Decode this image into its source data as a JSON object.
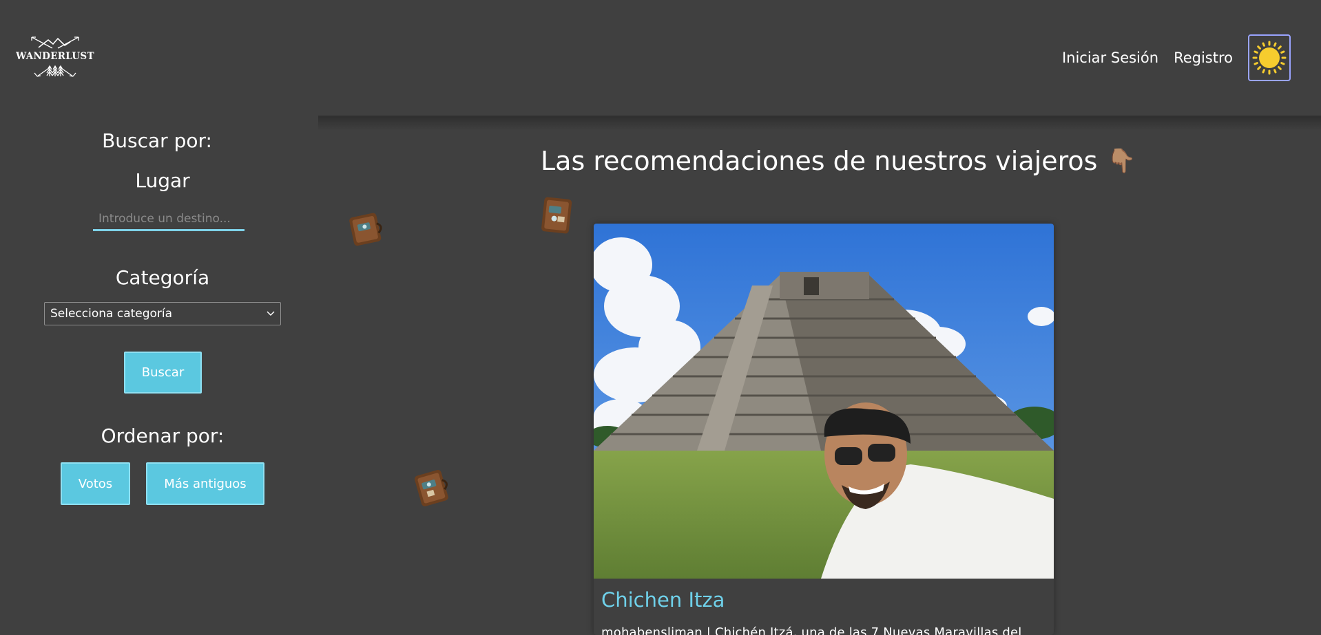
{
  "header": {
    "logo_text": "WANDERLUST",
    "nav": {
      "login": "Iniciar Sesión",
      "register": "Registro"
    },
    "theme_toggle_icon": "sun-icon"
  },
  "sidebar": {
    "search_heading": "Buscar por:",
    "place_label": "Lugar",
    "destination_placeholder": "Introduce un destino...",
    "category_label": "Categoría",
    "category_selected": "Selecciona categoría",
    "search_button": "Buscar",
    "sort_heading": "Ordenar por:",
    "sort_buttons": [
      "Votos",
      "Más antiguos"
    ]
  },
  "main": {
    "title": "Las recomendaciones de nuestros viajeros",
    "title_emoji": "👇🏽",
    "cards": [
      {
        "title": "Chichen Itza",
        "description": "mohabensliman | Chichén Itzá, una de las 7 Nuevas Maravillas del"
      }
    ]
  },
  "colors": {
    "background": "#404040",
    "accent": "#5bc8e0",
    "card_title": "#6fd1ea",
    "input_underline": "#7fd3ea",
    "toggle_border": "#9aa4ff",
    "sun": "#f6cc2e"
  }
}
